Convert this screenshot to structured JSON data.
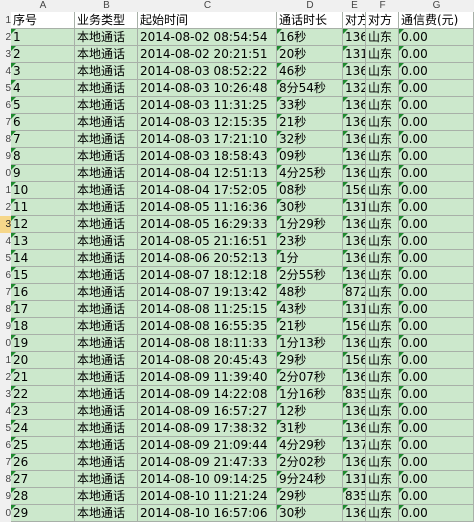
{
  "columns": [
    "A",
    "B",
    "C",
    "D",
    "E",
    "F",
    "G"
  ],
  "headers": [
    "序号",
    "业务类型",
    "起始时间",
    "通话时长",
    "对方",
    "对方",
    "通信费(元)"
  ],
  "row_numbers": [
    "1",
    "2",
    "3",
    "4",
    "5",
    "6",
    "7",
    "8",
    "9",
    "0",
    "1",
    "2",
    "3",
    "4",
    "5",
    "6",
    "7",
    "8",
    "9",
    "0",
    "1",
    "2",
    "3",
    "4",
    "5",
    "6",
    "7",
    "8",
    "9",
    "0"
  ],
  "active_row_index": 12,
  "rows": [
    [
      "1",
      "本地通话",
      "2014-08-02 08:54:54",
      "16秒",
      "136",
      "山东",
      "0.00"
    ],
    [
      "2",
      "本地通话",
      "2014-08-02 20:21:51",
      "20秒",
      "131",
      "山东",
      "0.00"
    ],
    [
      "3",
      "本地通话",
      "2014-08-03 08:52:22",
      "46秒",
      "136",
      "山东",
      "0.00"
    ],
    [
      "4",
      "本地通话",
      "2014-08-03 10:26:48",
      "8分54秒",
      "132",
      "山东",
      "0.00"
    ],
    [
      "5",
      "本地通话",
      "2014-08-03 11:31:25",
      "33秒",
      "136",
      "山东",
      "0.00"
    ],
    [
      "6",
      "本地通话",
      "2014-08-03 12:15:35",
      "21秒",
      "136",
      "山东",
      "0.00"
    ],
    [
      "7",
      "本地通话",
      "2014-08-03 17:21:10",
      "32秒",
      "136",
      "山东",
      "0.00"
    ],
    [
      "8",
      "本地通话",
      "2014-08-03 18:58:43",
      "09秒",
      "136",
      "山东",
      "0.00"
    ],
    [
      "9",
      "本地通话",
      "2014-08-04 12:51:13",
      "4分25秒",
      "136",
      "山东",
      "0.00"
    ],
    [
      "10",
      "本地通话",
      "2014-08-04 17:52:05",
      "08秒",
      "156",
      "山东",
      "0.00"
    ],
    [
      "11",
      "本地通话",
      "2014-08-05 11:16:36",
      "30秒",
      "131",
      "山东",
      "0.00"
    ],
    [
      "12",
      "本地通话",
      "2014-08-05 16:29:33",
      "1分29秒",
      "136",
      "山东",
      "0.00"
    ],
    [
      "13",
      "本地通话",
      "2014-08-05 21:16:51",
      "23秒",
      "136",
      "山东",
      "0.00"
    ],
    [
      "14",
      "本地通话",
      "2014-08-06 20:52:13",
      "1分",
      "136",
      "山东",
      "0.00"
    ],
    [
      "15",
      "本地通话",
      "2014-08-07 18:12:18",
      "2分55秒",
      "136",
      "山东",
      "0.00"
    ],
    [
      "16",
      "本地通话",
      "2014-08-07 19:13:42",
      "48秒",
      "872",
      "山东",
      "0.00"
    ],
    [
      "17",
      "本地通话",
      "2014-08-08 11:25:15",
      "43秒",
      "131",
      "山东",
      "0.00"
    ],
    [
      "18",
      "本地通话",
      "2014-08-08 16:55:35",
      "21秒",
      "156",
      "山东",
      "0.00"
    ],
    [
      "19",
      "本地通话",
      "2014-08-08 18:11:33",
      "1分13秒",
      "136",
      "山东",
      "0.00"
    ],
    [
      "20",
      "本地通话",
      "2014-08-08 20:45:43",
      "29秒",
      "156",
      "山东",
      "0.00"
    ],
    [
      "21",
      "本地通话",
      "2014-08-09 11:39:40",
      "2分07秒",
      "136",
      "山东",
      "0.00"
    ],
    [
      "22",
      "本地通话",
      "2014-08-09 14:22:08",
      "1分16秒",
      "835",
      "山东",
      "0.00"
    ],
    [
      "23",
      "本地通话",
      "2014-08-09 16:57:27",
      "12秒",
      "136",
      "山东",
      "0.00"
    ],
    [
      "24",
      "本地通话",
      "2014-08-09 17:38:32",
      "31秒",
      "136",
      "山东",
      "0.00"
    ],
    [
      "25",
      "本地通话",
      "2014-08-09 21:09:44",
      "4分29秒",
      "137",
      "山东",
      "0.00"
    ],
    [
      "26",
      "本地通话",
      "2014-08-09 21:47:33",
      "2分02秒",
      "136",
      "山东",
      "0.00"
    ],
    [
      "27",
      "本地通话",
      "2014-08-10 09:14:25",
      "9分24秒",
      "131",
      "山东",
      "0.00"
    ],
    [
      "28",
      "本地通话",
      "2014-08-10 11:21:24",
      "29秒",
      "835",
      "山东",
      "0.00"
    ],
    [
      "29",
      "本地通话",
      "2014-08-10 16:57:06",
      "30秒",
      "136",
      "山东",
      "0.00"
    ]
  ]
}
